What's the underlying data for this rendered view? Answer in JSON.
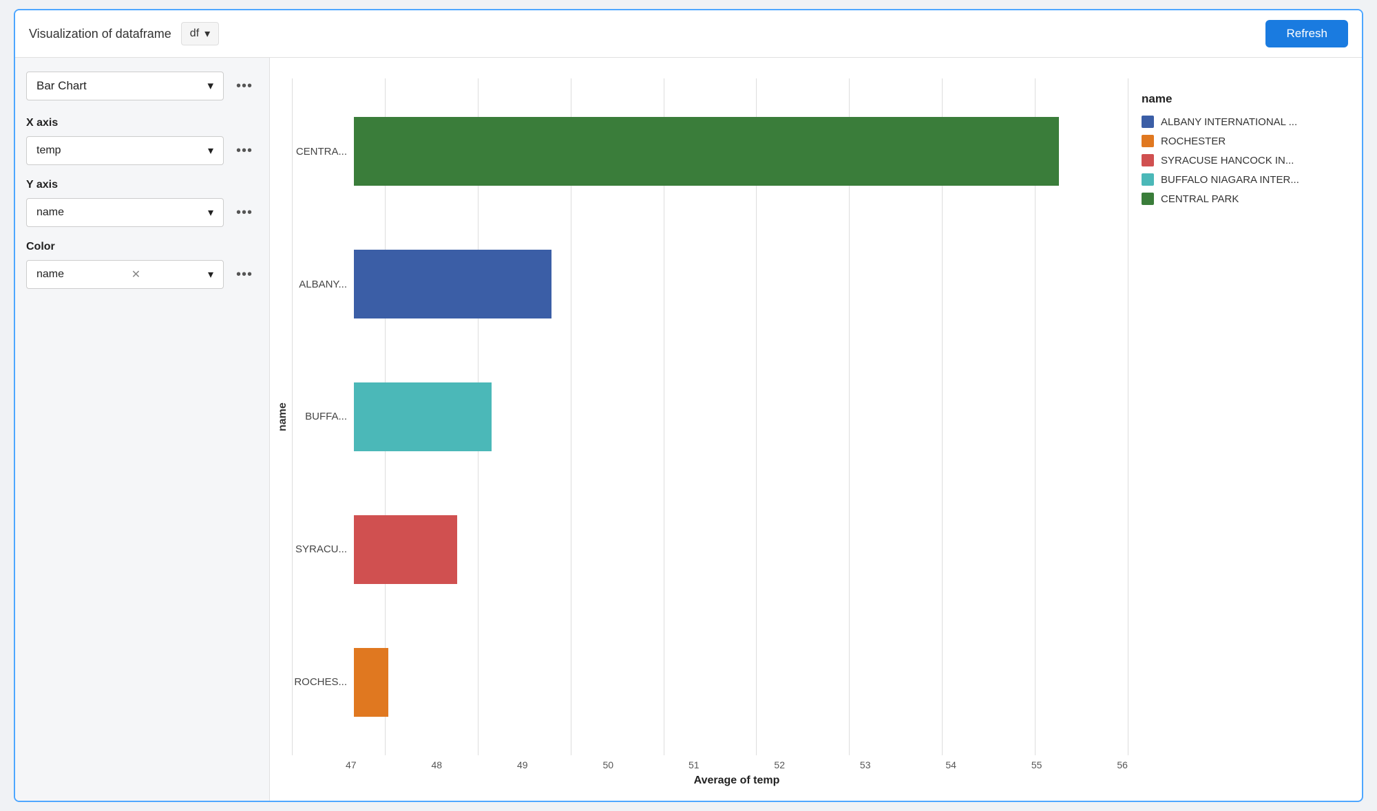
{
  "header": {
    "title": "Visualization of dataframe",
    "df_label": "df",
    "refresh_label": "Refresh"
  },
  "sidebar": {
    "chart_type": "Bar Chart",
    "x_axis_label": "X axis",
    "x_axis_value": "temp",
    "y_axis_label": "Y axis",
    "y_axis_value": "name",
    "color_label": "Color",
    "color_value": "name"
  },
  "chart": {
    "y_axis_label": "name",
    "x_axis_label": "Average of temp",
    "x_ticks": [
      "47",
      "48",
      "49",
      "50",
      "51",
      "52",
      "53",
      "54",
      "55",
      "56"
    ],
    "bars": [
      {
        "label": "CENTRA...",
        "value": 55.2,
        "color": "#3a7d3a"
      },
      {
        "label": "ALBANY...",
        "value": 49.3,
        "color": "#3b5ea6"
      },
      {
        "label": "BUFFA...",
        "value": 48.6,
        "color": "#4bb8b8"
      },
      {
        "label": "SYRACU...",
        "value": 48.2,
        "color": "#d05050"
      },
      {
        "label": "ROCHES...",
        "value": 47.4,
        "color": "#e07820"
      }
    ],
    "x_min": 47,
    "x_max": 56
  },
  "legend": {
    "title": "name",
    "items": [
      {
        "label": "ALBANY INTERNATIONAL ...",
        "color": "#3b5ea6"
      },
      {
        "label": "ROCHESTER",
        "color": "#e07820"
      },
      {
        "label": "SYRACUSE HANCOCK IN...",
        "color": "#d05050"
      },
      {
        "label": "BUFFALO NIAGARA INTER...",
        "color": "#4bb8b8"
      },
      {
        "label": "CENTRAL PARK",
        "color": "#3a7d3a"
      }
    ]
  }
}
